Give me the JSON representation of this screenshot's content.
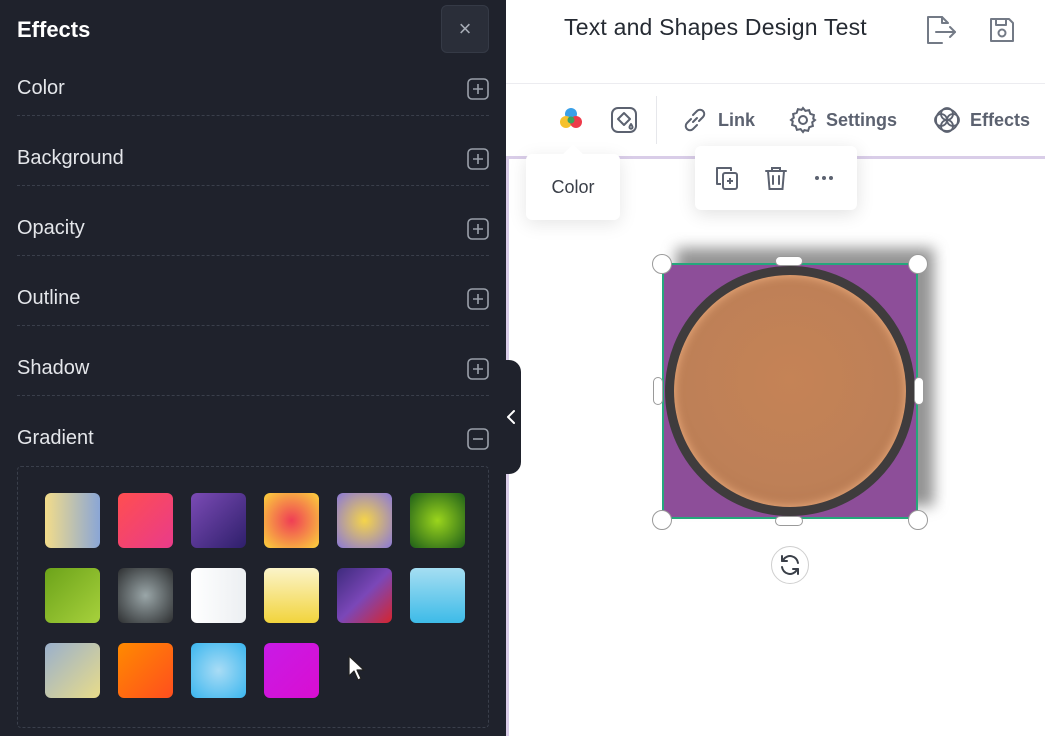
{
  "header": {
    "title": "Text and Shapes Design Test",
    "export_icon": "export-icon",
    "save_icon": "save-icon"
  },
  "toolbar": {
    "color_icon": "color-palette-icon",
    "fill_icon": "paint-bucket-icon",
    "link_label": "Link",
    "settings_label": "Settings",
    "effects_label": "Effects"
  },
  "tooltip": {
    "text": "Color"
  },
  "float_menu": {
    "items": [
      "duplicate-icon",
      "delete-icon",
      "more-icon"
    ]
  },
  "shape": {
    "fill_color": "#8d4e99",
    "circle_color": "#be8057",
    "outline_color": "#3f3c3d",
    "selection_color": "#26a77c",
    "rotate_icon": "rotate-icon"
  },
  "panel": {
    "title": "Effects",
    "close_label": "×",
    "sections": [
      {
        "label": "Color",
        "state": "collapsed"
      },
      {
        "label": "Background",
        "state": "collapsed"
      },
      {
        "label": "Opacity",
        "state": "collapsed"
      },
      {
        "label": "Outline",
        "state": "collapsed"
      },
      {
        "label": "Shadow",
        "state": "collapsed"
      },
      {
        "label": "Gradient",
        "state": "expanded"
      }
    ],
    "gradients": [
      "linear-gradient(90deg,#f2dc8a,#8aa6d6)",
      "linear-gradient(135deg,#ff4e50,#e93b8a)",
      "linear-gradient(135deg,#7b4bb5,#2e1f6b)",
      "radial-gradient(circle,#ef3e55,#fbd23c)",
      "radial-gradient(circle,#f5d44a,#8a78d8)",
      "radial-gradient(circle,#9bd51c,#1d5e1a)",
      "linear-gradient(135deg,#6ca31a,#a7d13c)",
      "radial-gradient(circle,#9aa6a8,#2d2f31)",
      "linear-gradient(90deg,#ffffff,#eceff2)",
      "linear-gradient(180deg,#fbf4c9,#f2d43c)",
      "linear-gradient(135deg,#3e2b7d,#7b47b8 50%,#d6252e)",
      "linear-gradient(180deg,#a5def2,#3dbbe8)",
      "linear-gradient(135deg,#9ab0cc,#e8dc8a)",
      "linear-gradient(135deg,#ff8a00,#ff4e1e)",
      "radial-gradient(circle,#a9dcf5,#3ab6ef)",
      "linear-gradient(135deg,#c81be6,#d90ed1)"
    ]
  }
}
